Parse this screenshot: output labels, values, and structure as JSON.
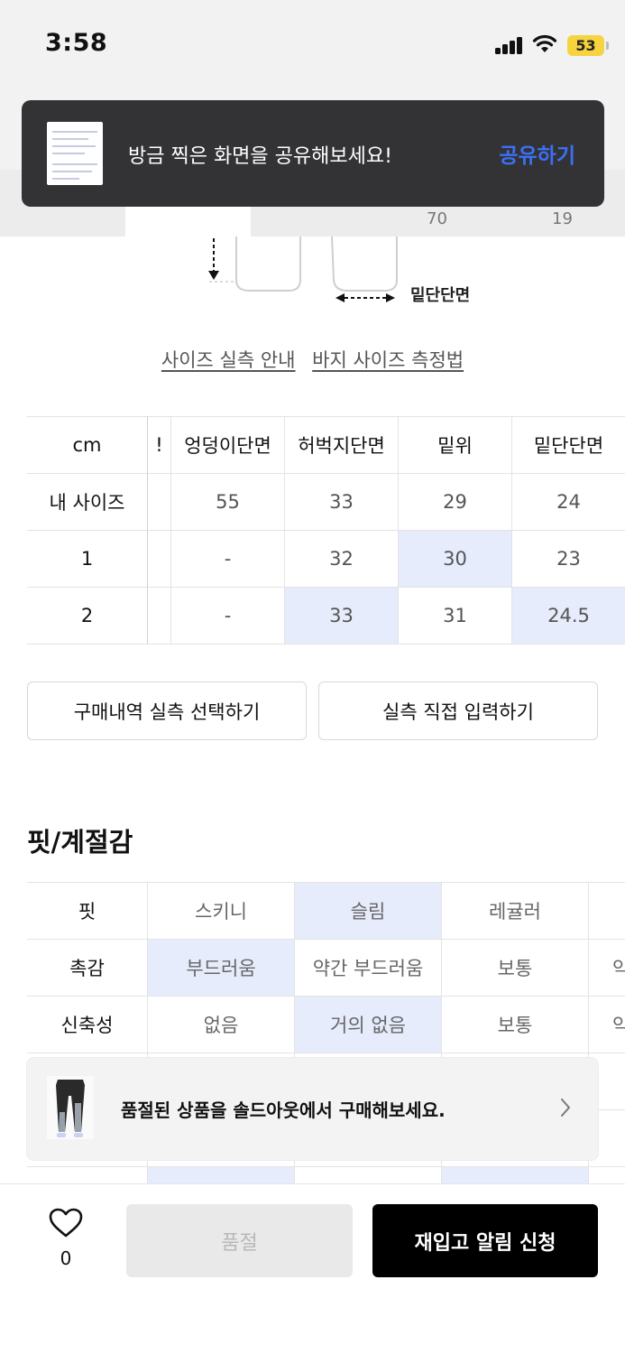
{
  "status_bar": {
    "time": "3:58",
    "battery": "53"
  },
  "toast": {
    "message": "방금 찍은 화면을 공유해보세요!",
    "action": "공유하기"
  },
  "tabs_peek": {
    "col4_value": "70",
    "col5_value": "19"
  },
  "diagram": {
    "hem_label": "밑단단면"
  },
  "links": {
    "size_guide": "사이즈 실측 안내",
    "pants_measure": "바지 사이즈 측정법"
  },
  "size_table": {
    "headers": [
      "cm",
      "!",
      "엉덩이단면",
      "허벅지단면",
      "밑위",
      "밑단단면"
    ],
    "rows": [
      {
        "label": "내 사이즈",
        "values": [
          "",
          "55",
          "33",
          "29",
          "24"
        ]
      },
      {
        "label": "1",
        "values": [
          "",
          "-",
          "32",
          "30",
          "23"
        ]
      },
      {
        "label": "2",
        "values": [
          "",
          "-",
          "33",
          "31",
          "24.5"
        ]
      }
    ]
  },
  "buttons": {
    "purchase_history": "구매내역 실측 선택하기",
    "direct_input": "실측 직접 입력하기"
  },
  "fit_section": {
    "title": "핏/계절감",
    "rows": [
      {
        "label": "핏",
        "options": [
          "스키니",
          "슬림",
          "레귤러",
          ""
        ]
      },
      {
        "label": "촉감",
        "options": [
          "부드러움",
          "약간 부드러움",
          "보통",
          "약"
        ]
      },
      {
        "label": "신축성",
        "options": [
          "없음",
          "거의 없음",
          "보통",
          "약"
        ]
      }
    ]
  },
  "banner": {
    "text": "품절된 상품을 솔드아웃에서 구매해보세요."
  },
  "bottom_bar": {
    "like_count": "0",
    "soldout_label": "품절",
    "restock_label": "재입고 알림 신청"
  },
  "colors": {
    "accent": "#3b6ff5",
    "highlight": "#e6ecfc",
    "toast_bg": "#333336"
  }
}
